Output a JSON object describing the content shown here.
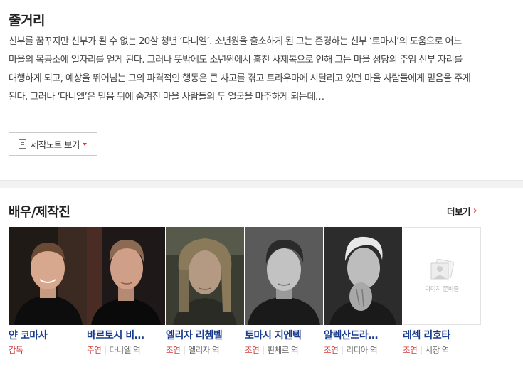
{
  "synopsis": {
    "title": "줄거리",
    "text": "신부를 꿈꾸지만 신부가 될 수 없는 20살 청년 ‘다니엘’. 소년원을 출소하게 된 그는 존경하는 신부 ‘토마시’의 도움으로 어느 마을의 목공소에 일자리를 얻게 된다. 그러나 뜻밖에도 소년원에서 훔친 사제복으로 인해 그는 마을 성당의 주임 신부 자리를 대행하게 되고, 예상을 뛰어넘는 그의 파격적인 행동은 큰 사고를 겪고 트라우마에 시달리고 있던 마을 사람들에게 믿음을 주게 된다. 그러나 ‘다니엘’은 믿음 뒤에 숨겨진 마을 사람들의 두 얼굴을 마주하게 되는데…",
    "notes_button": "제작노트 보기"
  },
  "cast": {
    "title": "배우/제작진",
    "more": "더보기",
    "no_image_text": "이미지 준비중",
    "accent_color": "#d23c3c",
    "name_color": "#1a3c8f",
    "people": [
      {
        "name": "얀 코마사",
        "role": "감독",
        "character": ""
      },
      {
        "name": "바르토시 비…",
        "role": "주연",
        "character": "다니엘 역"
      },
      {
        "name": "엘리자 리쳄벨",
        "role": "조연",
        "character": "엘리자 역"
      },
      {
        "name": "토마시 지엔텍",
        "role": "조연",
        "character": "핀체르 역"
      },
      {
        "name": "알렉산드라…",
        "role": "조연",
        "character": "리디아 역"
      },
      {
        "name": "레섹 리호타",
        "role": "조연",
        "character": "시장 역"
      }
    ]
  }
}
